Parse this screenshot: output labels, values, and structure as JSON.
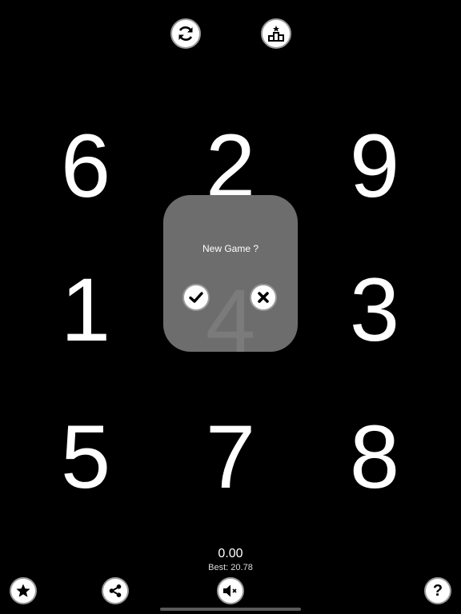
{
  "top_bar": {
    "restart_icon": "refresh-icon",
    "leaderboard_icon": "leaderboard-icon"
  },
  "grid": {
    "cells": [
      "6",
      "2",
      "9",
      "1",
      "4",
      "3",
      "5",
      "7",
      "8"
    ],
    "color": "#ffffff"
  },
  "dialog": {
    "title": "New Game ?",
    "confirm_icon": "check-icon",
    "cancel_icon": "close-icon",
    "background": "#6d6d6d"
  },
  "score": {
    "timer": "0.00",
    "best": "Best: 20.78"
  },
  "bottom_bar": {
    "rate_icon": "star-icon",
    "share_icon": "share-icon",
    "sound_icon": "mute-icon",
    "help_icon": "help-icon",
    "help_label": "?"
  }
}
